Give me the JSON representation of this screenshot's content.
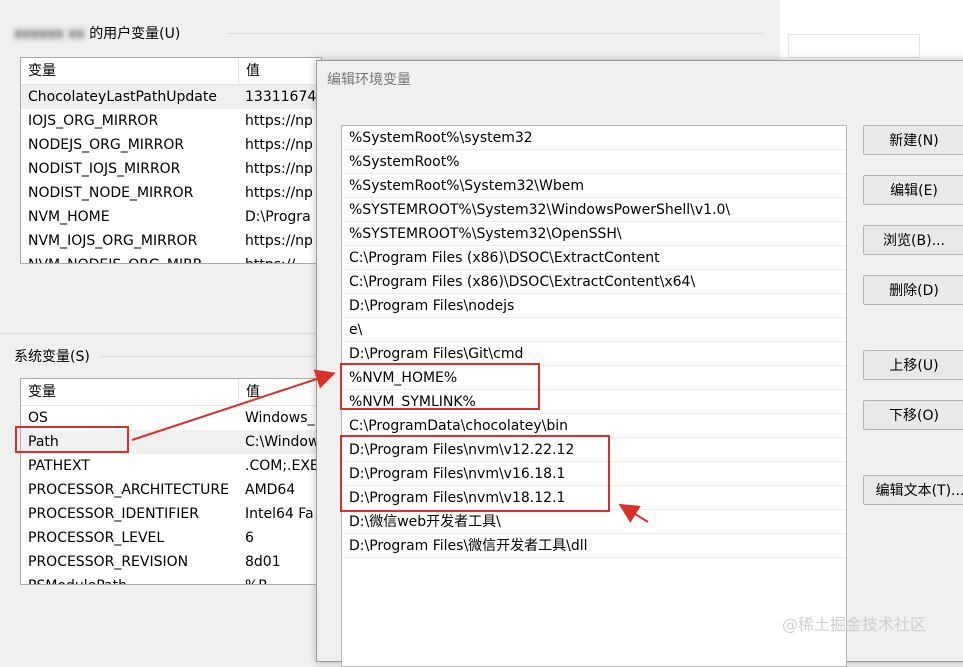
{
  "user_vars": {
    "group_title": "的用户变量(U)",
    "col_name": "变量",
    "col_value": "值",
    "rows": [
      {
        "name": "ChocolateyLastPathUpdate",
        "value": "13311674"
      },
      {
        "name": "IOJS_ORG_MIRROR",
        "value": "https://np"
      },
      {
        "name": "NODEJS_ORG_MIRROR",
        "value": "https://np"
      },
      {
        "name": "NODIST_IOJS_MIRROR",
        "value": "https://np"
      },
      {
        "name": "NODIST_NODE_MIRROR",
        "value": "https://np"
      },
      {
        "name": "NVM_HOME",
        "value": "D:\\Progra"
      },
      {
        "name": "NVM_IOJS_ORG_MIRROR",
        "value": "https://np"
      },
      {
        "name": "NVM_NODEJS_ORG_MIRR",
        "value": "https://"
      }
    ]
  },
  "sys_vars": {
    "group_title": "系统变量(S)",
    "col_name": "变量",
    "col_value": "值",
    "rows": [
      {
        "name": "OS",
        "value": "Windows_"
      },
      {
        "name": "Path",
        "value": "C:\\Window"
      },
      {
        "name": "PATHEXT",
        "value": ".COM;.EXE"
      },
      {
        "name": "PROCESSOR_ARCHITECTURE",
        "value": "AMD64"
      },
      {
        "name": "PROCESSOR_IDENTIFIER",
        "value": "Intel64 Fa"
      },
      {
        "name": "PROCESSOR_LEVEL",
        "value": "6"
      },
      {
        "name": "PROCESSOR_REVISION",
        "value": "8d01"
      },
      {
        "name": "PSModulePath",
        "value": "%P"
      }
    ]
  },
  "dialog": {
    "title": "编辑环境变量",
    "paths": [
      "%SystemRoot%\\system32",
      "%SystemRoot%",
      "%SystemRoot%\\System32\\Wbem",
      "%SYSTEMROOT%\\System32\\WindowsPowerShell\\v1.0\\",
      "%SYSTEMROOT%\\System32\\OpenSSH\\",
      "C:\\Program Files (x86)\\DSOC\\ExtractContent",
      "C:\\Program Files (x86)\\DSOC\\ExtractContent\\x64\\",
      "D:\\Program Files\\nodejs",
      "e\\",
      "D:\\Program Files\\Git\\cmd",
      "%NVM_HOME%",
      "%NVM_SYMLINK%",
      "C:\\ProgramData\\chocolatey\\bin",
      "D:\\Program Files\\nvm\\v12.22.12",
      "D:\\Program Files\\nvm\\v16.18.1",
      "D:\\Program Files\\nvm\\v18.12.1",
      "D:\\微信web开发者工具\\",
      "D:\\Program Files\\微信开发者工具\\dll"
    ],
    "buttons": {
      "new": "新建(N)",
      "edit": "编辑(E)",
      "browse": "浏览(B)...",
      "delete": "删除(D)",
      "up": "上移(U)",
      "down": "下移(O)",
      "edit_text": "编辑文本(T)..."
    }
  },
  "watermark": {
    "text": "@稀土掘金技术社区"
  },
  "colors": {
    "annotation_red": "#d9302c"
  }
}
